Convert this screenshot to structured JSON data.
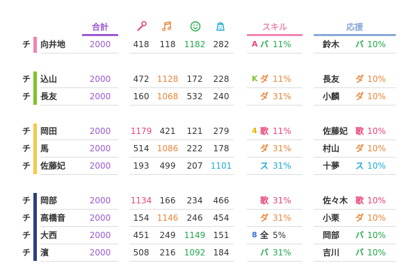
{
  "colors": {
    "total": "#9b59d0",
    "pink": "#e8457a",
    "orange": "#e8863a",
    "green": "#22a84a",
    "cyan": "#1fa9d6",
    "blue": "#3a6fd8",
    "yellow": "#e8b400",
    "lime": "#7dc42c",
    "gray": "#a0a0a0",
    "text": "#333333",
    "skill_header": "#ef85b3",
    "support_header": "#86a9d6"
  },
  "headers": {
    "total": "合計",
    "skill": "スキル",
    "support": "応援",
    "icons": [
      "microphone-icon",
      "music-note-icon",
      "smile-icon",
      "pudding-icon"
    ]
  },
  "groups": [
    {
      "stripe_color": "#ef85b3",
      "rows": [
        {
          "chi": "チ",
          "name": "向井地",
          "total": "2000",
          "vals": [
            {
              "v": "418",
              "c": "text"
            },
            {
              "v": "118",
              "c": "text"
            },
            {
              "v": "1182",
              "c": "green"
            },
            {
              "v": "282",
              "c": "text"
            }
          ],
          "skill": {
            "lv": "A",
            "lvc": "pink",
            "type": "バ",
            "tc": "green",
            "pct": "11%",
            "pc": "green"
          },
          "support": {
            "name": "鈴木",
            "type": "バ",
            "tc": "green",
            "pct": "10%",
            "pc": "green"
          }
        }
      ]
    },
    {
      "stripe_color": "#7dc42c",
      "rows": [
        {
          "chi": "チ",
          "name": "込山",
          "total": "2000",
          "vals": [
            {
              "v": "472",
              "c": "text"
            },
            {
              "v": "1128",
              "c": "orange"
            },
            {
              "v": "172",
              "c": "text"
            },
            {
              "v": "228",
              "c": "text"
            }
          ],
          "skill": {
            "lv": "K",
            "lvc": "lime",
            "type": "ダ",
            "tc": "orange",
            "pct": "11%",
            "pc": "orange"
          },
          "support": {
            "name": "長友",
            "type": "ダ",
            "tc": "orange",
            "pct": "10%",
            "pc": "orange"
          }
        },
        {
          "chi": "チ",
          "name": "長友",
          "total": "2000",
          "vals": [
            {
              "v": "160",
              "c": "text"
            },
            {
              "v": "1068",
              "c": "orange"
            },
            {
              "v": "532",
              "c": "text"
            },
            {
              "v": "240",
              "c": "text"
            }
          ],
          "skill": {
            "lv": "",
            "lvc": "text",
            "type": "ダ",
            "tc": "orange",
            "pct": "31%",
            "pc": "orange"
          },
          "support": {
            "name": "小麟",
            "type": "ダ",
            "tc": "orange",
            "pct": "10%",
            "pc": "orange"
          }
        }
      ]
    },
    {
      "stripe_color": "#f5c94a",
      "rows": [
        {
          "chi": "チ",
          "name": "岡田",
          "total": "2000",
          "vals": [
            {
              "v": "1179",
              "c": "pink"
            },
            {
              "v": "421",
              "c": "text"
            },
            {
              "v": "121",
              "c": "text"
            },
            {
              "v": "279",
              "c": "text"
            }
          ],
          "skill": {
            "lv": "4",
            "lvc": "yellow",
            "type": "歌",
            "tc": "pink",
            "pct": "11%",
            "pc": "pink"
          },
          "support": {
            "name": "佐藤妃",
            "type": "歌",
            "tc": "pink",
            "pct": "10%",
            "pc": "pink"
          }
        },
        {
          "chi": "チ",
          "name": "馬",
          "total": "2000",
          "vals": [
            {
              "v": "514",
              "c": "text"
            },
            {
              "v": "1086",
              "c": "orange"
            },
            {
              "v": "222",
              "c": "text"
            },
            {
              "v": "178",
              "c": "text"
            }
          ],
          "skill": {
            "lv": "",
            "lvc": "text",
            "type": "ダ",
            "tc": "orange",
            "pct": "31%",
            "pc": "orange"
          },
          "support": {
            "name": "村山",
            "type": "ダ",
            "tc": "orange",
            "pct": "10%",
            "pc": "orange"
          }
        },
        {
          "chi": "チ",
          "name": "佐藤妃",
          "total": "2000",
          "vals": [
            {
              "v": "193",
              "c": "text"
            },
            {
              "v": "499",
              "c": "text"
            },
            {
              "v": "207",
              "c": "text"
            },
            {
              "v": "1101",
              "c": "cyan"
            }
          ],
          "skill": {
            "lv": "",
            "lvc": "text",
            "type": "ス",
            "tc": "cyan",
            "pct": "31%",
            "pc": "cyan"
          },
          "support": {
            "name": "十夢",
            "type": "ス",
            "tc": "cyan",
            "pct": "10%",
            "pc": "cyan"
          }
        }
      ]
    },
    {
      "stripe_color": "#2a4080",
      "rows": [
        {
          "chi": "チ",
          "name": "岡部",
          "total": "2000",
          "vals": [
            {
              "v": "1134",
              "c": "pink"
            },
            {
              "v": "166",
              "c": "text"
            },
            {
              "v": "234",
              "c": "text"
            },
            {
              "v": "466",
              "c": "text"
            }
          ],
          "skill": {
            "lv": "",
            "lvc": "text",
            "type": "歌",
            "tc": "pink",
            "pct": "31%",
            "pc": "pink"
          },
          "support": {
            "name": "佐々木",
            "type": "歌",
            "tc": "pink",
            "pct": "10%",
            "pc": "pink"
          }
        },
        {
          "chi": "チ",
          "name": "高橋音",
          "total": "2000",
          "vals": [
            {
              "v": "154",
              "c": "text"
            },
            {
              "v": "1146",
              "c": "orange"
            },
            {
              "v": "246",
              "c": "text"
            },
            {
              "v": "454",
              "c": "text"
            }
          ],
          "skill": {
            "lv": "",
            "lvc": "text",
            "type": "ダ",
            "tc": "orange",
            "pct": "31%",
            "pc": "orange"
          },
          "support": {
            "name": "小栗",
            "type": "ダ",
            "tc": "orange",
            "pct": "10%",
            "pc": "orange"
          }
        },
        {
          "chi": "チ",
          "name": "大西",
          "total": "2000",
          "vals": [
            {
              "v": "451",
              "c": "text"
            },
            {
              "v": "249",
              "c": "text"
            },
            {
              "v": "1149",
              "c": "green"
            },
            {
              "v": "151",
              "c": "text"
            }
          ],
          "skill": {
            "lv": "8",
            "lvc": "blue",
            "type": "全",
            "tc": "text",
            "pct": "5%",
            "pc": "text"
          },
          "support": {
            "name": "岡部",
            "type": "バ",
            "tc": "green",
            "pct": "10%",
            "pc": "green"
          }
        },
        {
          "chi": "チ",
          "name": "濱",
          "total": "2000",
          "vals": [
            {
              "v": "508",
              "c": "text"
            },
            {
              "v": "216",
              "c": "text"
            },
            {
              "v": "1092",
              "c": "green"
            },
            {
              "v": "184",
              "c": "text"
            }
          ],
          "skill": {
            "lv": "",
            "lvc": "text",
            "type": "バ",
            "tc": "green",
            "pct": "31%",
            "pc": "green"
          },
          "support": {
            "name": "吉川",
            "type": "バ",
            "tc": "green",
            "pct": "10%",
            "pc": "green"
          }
        }
      ]
    }
  ]
}
